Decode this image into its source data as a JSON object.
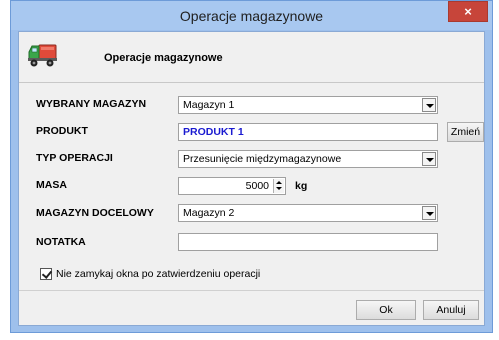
{
  "window": {
    "title": "Operacje magazynowe",
    "close_glyph": "×"
  },
  "header": {
    "title": "Operacje magazynowe",
    "icon": "truck-icon"
  },
  "form": {
    "warehouse_label": "WYBRANY MAGAZYN",
    "warehouse_value": "Magazyn 1",
    "product_label": "PRODUKT",
    "product_value": "PRODUKT 1",
    "change_button": "Zmień",
    "operation_type_label": "TYP OPERACJI",
    "operation_type_value": "Przesunięcie międzymagazynowe",
    "mass_label": "MASA",
    "mass_value": "5000",
    "mass_unit": "kg",
    "target_warehouse_label": "MAGAZYN DOCELOWY",
    "target_warehouse_value": "Magazyn 2",
    "note_label": "NOTATKA",
    "note_value": ""
  },
  "options": {
    "keep_open_label": "Nie zamykaj okna po zatwierdzeniu operacji",
    "keep_open_checked": true
  },
  "footer": {
    "ok_label": "Ok",
    "cancel_label": "Anuluj"
  },
  "colors": {
    "titlebar": "#a8c8f0",
    "close": "#c7453a",
    "product_text": "#1a1ad0"
  }
}
